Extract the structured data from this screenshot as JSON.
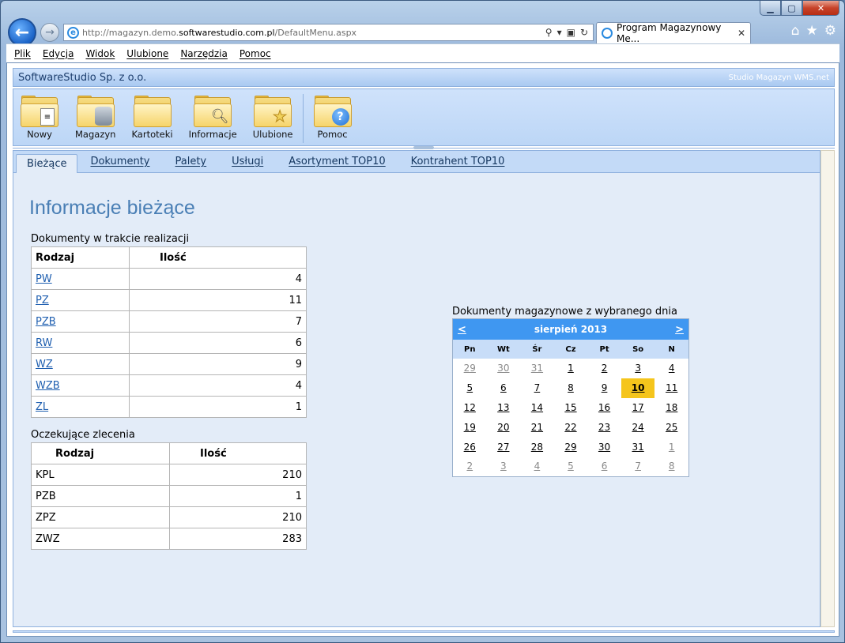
{
  "browser": {
    "url_prefix": "http://magazyn.demo.",
    "url_domain": "softwarestudio.com.pl",
    "url_path": "/DefaultMenu.aspx",
    "tab_title": "Program Magazynowy Me...",
    "menu": [
      "Plik",
      "Edycja",
      "Widok",
      "Ulubione",
      "Narzędzia",
      "Pomoc"
    ]
  },
  "app": {
    "company": "SoftwareStudio Sp. z o.o.",
    "product": "Studio Magazyn WMS.net",
    "toolbar": [
      {
        "label": "Nowy",
        "icon": "new-document-folder-icon"
      },
      {
        "label": "Magazyn",
        "icon": "database-folder-icon"
      },
      {
        "label": "Kartoteki",
        "icon": "folder-icon"
      },
      {
        "label": "Informacje",
        "icon": "search-folder-icon"
      },
      {
        "label": "Ulubione",
        "icon": "star-folder-icon"
      },
      {
        "label": "Pomoc",
        "icon": "help-folder-icon"
      }
    ],
    "tabs": [
      "Bieżące",
      "Dokumenty",
      "Palety",
      "Usługi",
      "Asortyment TOP10",
      "Kontrahent TOP10"
    ]
  },
  "main": {
    "title": "Informacje bieżące",
    "docs_caption": "Dokumenty w trakcie realizacji",
    "docs_headers": [
      "Rodzaj",
      "Ilość"
    ],
    "docs_rows": [
      {
        "type": "PW",
        "qty": "4"
      },
      {
        "type": "PZ",
        "qty": "11"
      },
      {
        "type": "PZB",
        "qty": "7"
      },
      {
        "type": "RW",
        "qty": "6"
      },
      {
        "type": "WZ",
        "qty": "9"
      },
      {
        "type": "WZB",
        "qty": "4"
      },
      {
        "type": "ZL",
        "qty": "1"
      }
    ],
    "orders_caption": "Oczekujące zlecenia",
    "orders_headers": [
      "Rodzaj",
      "Ilość"
    ],
    "orders_rows": [
      {
        "type": "KPL",
        "qty": "210"
      },
      {
        "type": "PZB",
        "qty": "1"
      },
      {
        "type": "ZPZ",
        "qty": "210"
      },
      {
        "type": "ZWZ",
        "qty": "283"
      }
    ],
    "calendar_caption": "Dokumenty magazynowe z wybranego dnia",
    "calendar": {
      "prev": "<",
      "next": ">",
      "month": "sierpień 2013",
      "dow": [
        "Pn",
        "Wt",
        "Śr",
        "Cz",
        "Pt",
        "So",
        "N"
      ],
      "selected": "10",
      "weeks": [
        [
          "29",
          "30",
          "31",
          "1",
          "2",
          "3",
          "4"
        ],
        [
          "5",
          "6",
          "7",
          "8",
          "9",
          "10",
          "11"
        ],
        [
          "12",
          "13",
          "14",
          "15",
          "16",
          "17",
          "18"
        ],
        [
          "19",
          "20",
          "21",
          "22",
          "23",
          "24",
          "25"
        ],
        [
          "26",
          "27",
          "28",
          "29",
          "30",
          "31",
          "1"
        ],
        [
          "2",
          "3",
          "4",
          "5",
          "6",
          "7",
          "8"
        ]
      ],
      "other_month": [
        [
          0,
          0
        ],
        [
          0,
          1
        ],
        [
          0,
          2
        ],
        [
          4,
          6
        ],
        [
          5,
          0
        ],
        [
          5,
          1
        ],
        [
          5,
          2
        ],
        [
          5,
          3
        ],
        [
          5,
          4
        ],
        [
          5,
          5
        ],
        [
          5,
          6
        ]
      ]
    }
  }
}
